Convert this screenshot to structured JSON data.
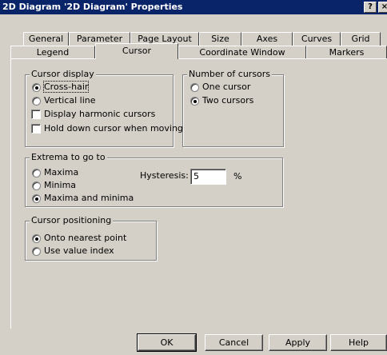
{
  "window": {
    "title": "2D Diagram '2D Diagram' Properties",
    "help_btn": "?",
    "close_btn": "×"
  },
  "tabs_row1": [
    "General",
    "Parameter",
    "Page Layout",
    "Size",
    "Axes",
    "Curves",
    "Grid"
  ],
  "tabs_row2": [
    "Legend",
    "Cursor",
    "Coordinate Window",
    "Markers"
  ],
  "active_tab": "Cursor",
  "cursor_display": {
    "title": "Cursor display",
    "options": [
      "Cross-hair",
      "Vertical line"
    ],
    "selected": "Cross-hair",
    "checks": [
      {
        "label": "Display harmonic cursors",
        "checked": false
      },
      {
        "label": "Hold down cursor when moving",
        "checked": false
      }
    ]
  },
  "number_of_cursors": {
    "title": "Number of cursors",
    "options": [
      "One cursor",
      "Two cursors"
    ],
    "selected": "Two cursors"
  },
  "extrema": {
    "title": "Extrema to go to",
    "options": [
      "Maxima",
      "Minima",
      "Maxima and minima"
    ],
    "selected": "Maxima and minima",
    "hysteresis_label": "Hysteresis:",
    "hysteresis_value": "5",
    "hysteresis_unit": "%"
  },
  "cursor_positioning": {
    "title": "Cursor positioning",
    "options": [
      "Onto nearest point",
      "Use value index"
    ],
    "selected": "Onto nearest point"
  },
  "buttons": {
    "ok": "OK",
    "cancel": "Cancel",
    "apply": "Apply",
    "help": "Help"
  }
}
